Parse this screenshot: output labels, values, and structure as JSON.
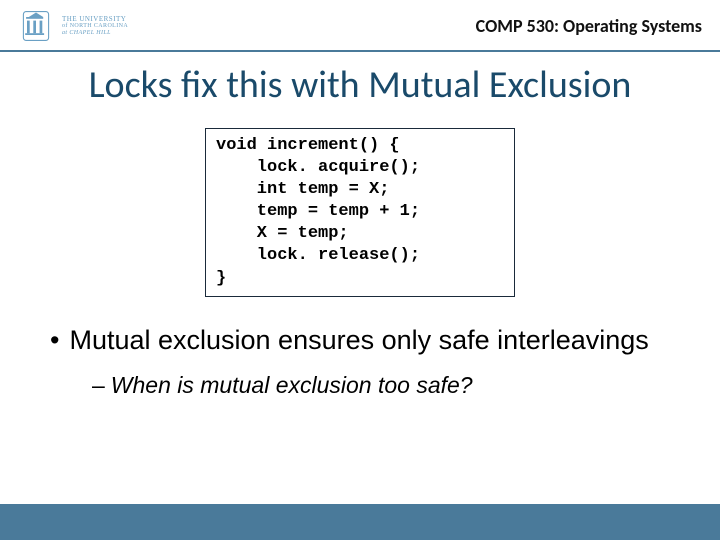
{
  "header": {
    "logo": {
      "line1": "THE UNIVERSITY",
      "line2": "of NORTH CAROLINA",
      "line3": "at CHAPEL HILL"
    },
    "course": "COMP 530: Operating Systems"
  },
  "title": "Locks fix this with Mutual Exclusion",
  "code": "void increment() {\n    lock. acquire();\n    int temp = X;\n    temp = temp + 1;\n    X = temp;\n    lock. release();\n}",
  "bullets": {
    "b1": "Mutual exclusion ensures only safe interleavings",
    "b2": "When is mutual exclusion too safe?"
  }
}
